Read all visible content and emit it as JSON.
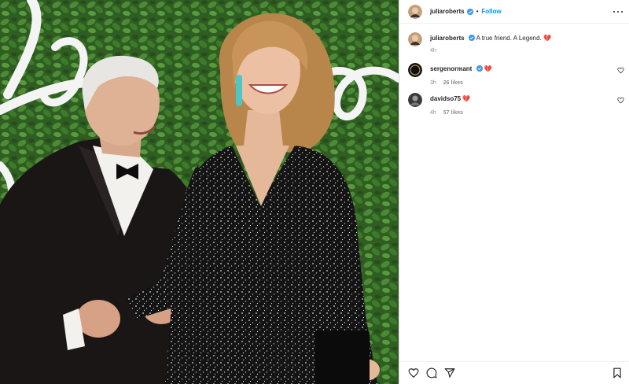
{
  "post": {
    "author": "juliaroberts",
    "follow_label": "Follow",
    "separator": "•"
  },
  "caption": {
    "author": "juliaroberts",
    "text": "A true friend. A Legend.",
    "emoji": "💔",
    "time": "4h"
  },
  "comments": [
    {
      "author": "sergenormant",
      "text": "💔",
      "time": "3h",
      "likes": "26 likes"
    },
    {
      "author": "davidso75",
      "text": "💔",
      "time": "4h",
      "likes": "57 likes"
    }
  ],
  "colors": {
    "accent": "#0095f6",
    "verified": "#3897f0",
    "text": "#262626",
    "muted": "#8e8e8e",
    "heartbreak": "#e0245e"
  },
  "icons": [
    "more-options-icon",
    "verified-badge-icon",
    "heart-icon",
    "comment-icon",
    "share-icon",
    "bookmark-icon"
  ]
}
